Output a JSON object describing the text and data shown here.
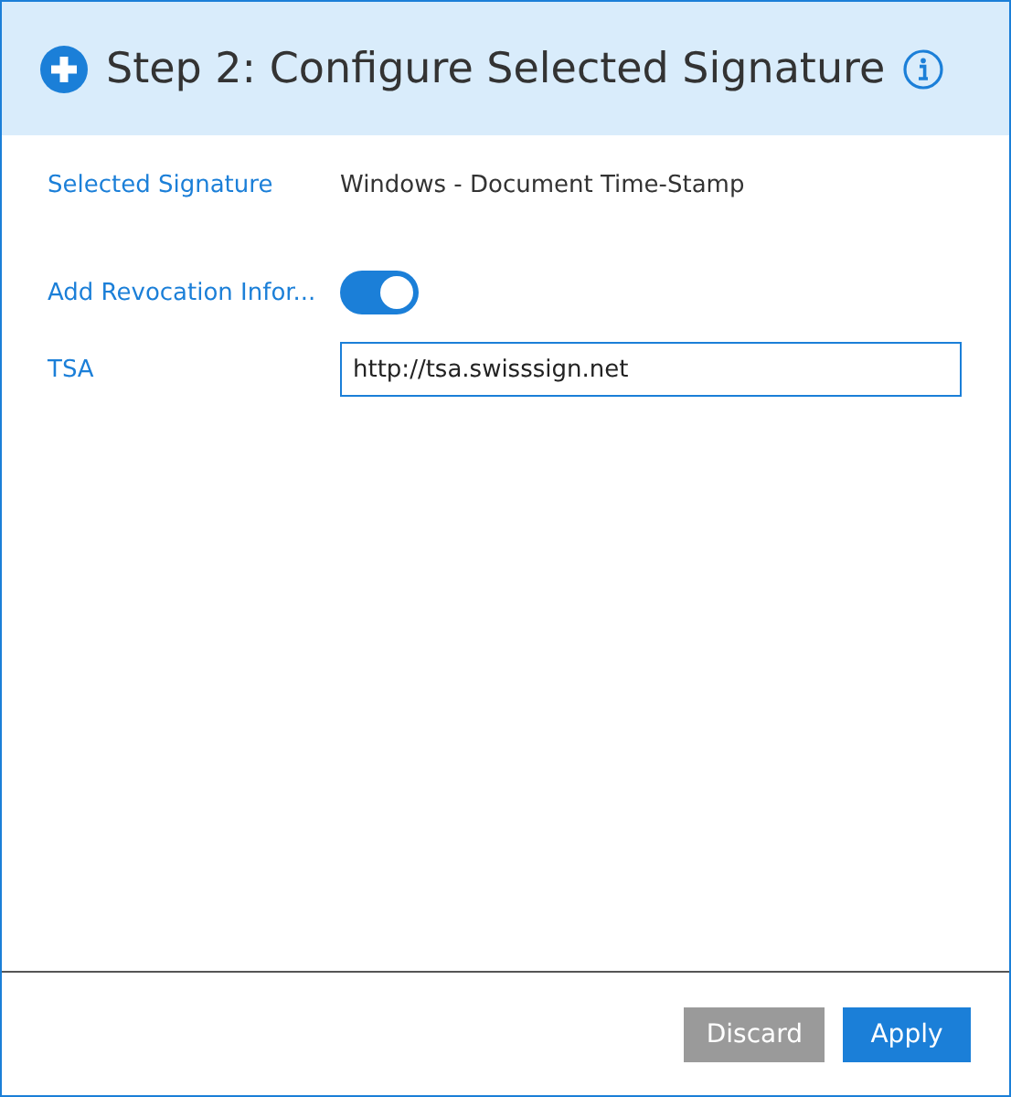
{
  "dialog": {
    "title": "Step 2: Configure Selected Signature"
  },
  "fields": [
    {
      "kind": "text",
      "label": "Selected Signature",
      "value": "Windows - Document Time-Stamp"
    },
    {
      "kind": "toggle",
      "label": "Add Revocation Infor...",
      "on": true
    },
    {
      "kind": "input",
      "label": "TSA",
      "value": "http://tsa.swisssign.net"
    }
  ],
  "buttons": [
    {
      "label": "Discard",
      "kind": "secondary"
    },
    {
      "label": "Apply",
      "kind": "primary"
    }
  ]
}
